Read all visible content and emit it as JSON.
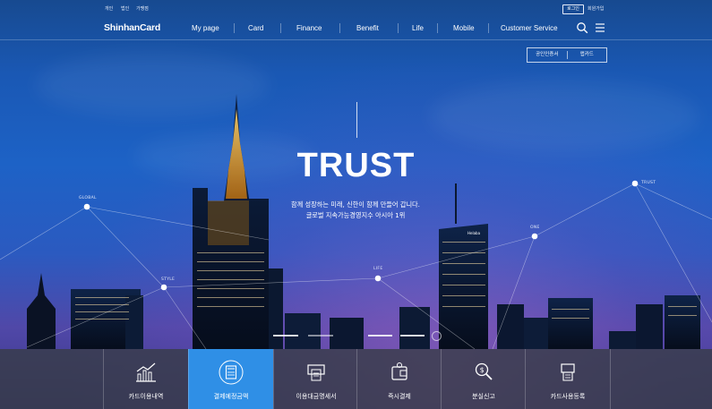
{
  "utility": {
    "links": [
      "개인",
      "법인",
      "가맹점"
    ],
    "login_label": "로그인",
    "join_label": "회원가입"
  },
  "brand": {
    "logo": "ShinhanCard"
  },
  "nav": {
    "items": [
      "My page",
      "Card",
      "Finance",
      "Benefit",
      "Life",
      "Mobile",
      "Customer Service"
    ]
  },
  "cert": {
    "public_cert": "공인인증서",
    "app_card": "앱카드"
  },
  "hero": {
    "title": "TRUST",
    "line1": "함께 성장하는 미래, 신한이 함께 만들어 갑니다.",
    "line2": "글로벌 지속가능경영지수 아시아 1위",
    "network_labels": [
      "GLOBAL",
      "STYLE",
      "LIFE",
      "ONE",
      "TRUST"
    ],
    "building_sign": "Helaba"
  },
  "quick_menu": [
    {
      "label": "카드이용내역",
      "icon": "chart-icon",
      "active": false
    },
    {
      "label": "결제예정금액",
      "icon": "calculator-icon",
      "active": true
    },
    {
      "label": "이용대금명세서",
      "icon": "statement-icon",
      "active": false
    },
    {
      "label": "즉시결제",
      "icon": "wallet-icon",
      "active": false
    },
    {
      "label": "분실신고",
      "icon": "search-coin-icon",
      "active": false
    },
    {
      "label": "카드사용등록",
      "icon": "card-register-icon",
      "active": false
    }
  ],
  "colors": {
    "active_tab": "#2f8fe6",
    "sky": "#1d62c6"
  }
}
